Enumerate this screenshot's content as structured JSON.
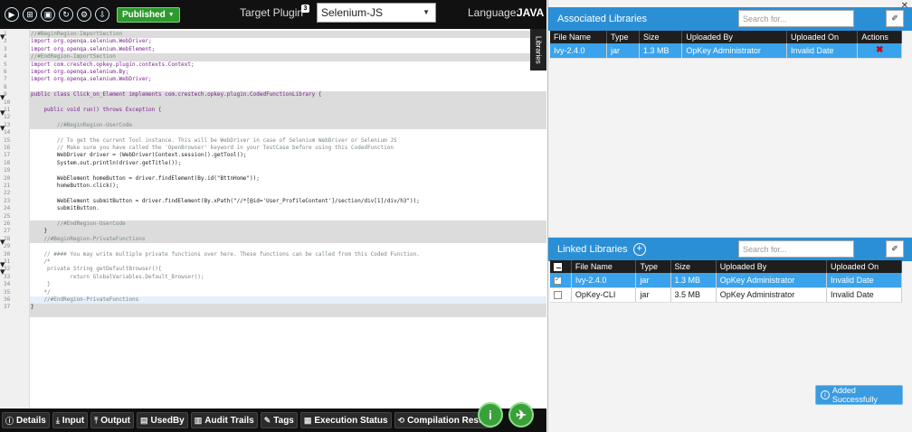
{
  "toolbar": {
    "icons": [
      "play-icon",
      "add-icon",
      "save-icon",
      "refresh-icon",
      "debug-icon",
      "export-icon"
    ],
    "published_label": "Published",
    "target_plugin_label": "Target Plugin",
    "target_plugin_badge": "3",
    "target_plugin_value": "Selenium-JS",
    "language_label": "Language:",
    "language_value": "JAVA",
    "libraries_tab": "Libraries"
  },
  "editor": {
    "lines": [
      {
        "n": "1",
        "t": "//#BeginRegion-ImportSection",
        "c": "cm",
        "g": true,
        "f": "▾"
      },
      {
        "n": "2",
        "t": "import org.openqa.selenium.WebDriver;",
        "c": "kw"
      },
      {
        "n": "3",
        "t": "import org.openqa.selenium.WebElement;",
        "c": "kw"
      },
      {
        "n": "4",
        "t": "//#EndRegion-ImportSection",
        "c": "cm",
        "g": true
      },
      {
        "n": "5",
        "t": "import com.crestech.opkey.plugin.contexts.Context;",
        "c": "kw"
      },
      {
        "n": "6",
        "t": "import org.openqa.selenium.By;",
        "c": "kw"
      },
      {
        "n": "7",
        "t": "import org.openqa.selenium.WebDriver;",
        "c": "kw"
      },
      {
        "n": "8",
        "t": "",
        "c": "nm"
      },
      {
        "n": "9",
        "t": "public class Click_on_Element implements com.crestech.opkey.plugin.CodedFunctionLibrary {",
        "c": "kw",
        "g": true,
        "f": "▾"
      },
      {
        "n": "10",
        "t": "",
        "c": "nm",
        "g": true
      },
      {
        "n": "11",
        "t": "    public void run() throws Exception {",
        "c": "kw",
        "g": true,
        "f": "▾"
      },
      {
        "n": "12",
        "t": "",
        "c": "nm",
        "g": true
      },
      {
        "n": "13",
        "t": "        //#BeginRegion-UserCode",
        "c": "cm",
        "g": true,
        "f": "▾"
      },
      {
        "n": "14",
        "t": "",
        "c": "nm"
      },
      {
        "n": "15",
        "t": "        // To get the current Tool instance. This will be WebDriver in case of Selenium WebDriver or Selenium JS",
        "c": "cm"
      },
      {
        "n": "16",
        "t": "        // Make sure you have called the 'OpenBrowser' keyword in your TestCase before using this CodedFunction",
        "c": "cm"
      },
      {
        "n": "17",
        "t": "        WebDriver driver = (WebDriver)Context.session().getTool();",
        "c": "nm"
      },
      {
        "n": "18",
        "t": "        System.out.println(driver.getTitle());",
        "c": "nm"
      },
      {
        "n": "19",
        "t": "",
        "c": "nm"
      },
      {
        "n": "20",
        "t": "        WebElement homeButton = driver.findElement(By.id(\"BttnHome\"));",
        "c": "nm"
      },
      {
        "n": "21",
        "t": "        homeButton.click();",
        "c": "nm"
      },
      {
        "n": "22",
        "t": "",
        "c": "nm"
      },
      {
        "n": "23",
        "t": "        WebElement submitButton = driver.findElement(By.xPath(\"//*[@id='User_ProfileContent']/section/div[1]/div/h3\"));",
        "c": "nm"
      },
      {
        "n": "24",
        "t": "        submitButton.",
        "c": "nm"
      },
      {
        "n": "25",
        "t": "",
        "c": "nm"
      },
      {
        "n": "26",
        "t": "        //#EndRegion-UserCode",
        "c": "cm",
        "g": true
      },
      {
        "n": "27",
        "t": "    }",
        "c": "nm",
        "g": true
      },
      {
        "n": "28",
        "t": "    //#BeginRegion-PrivateFunctions",
        "c": "cm",
        "g": true,
        "f": "▾"
      },
      {
        "n": "29",
        "t": "",
        "c": "nm"
      },
      {
        "n": "30",
        "t": "    // #### You may write multiple private functions over here. These functions can be called from this Coded Function.",
        "c": "cm"
      },
      {
        "n": "31",
        "t": "    /*",
        "c": "cm",
        "f": "▾"
      },
      {
        "n": "32",
        "t": "     private String getDefaultBrowser(){",
        "c": "cm",
        "f": "▾"
      },
      {
        "n": "33",
        "t": "            return GlobalVariables.Default_Browser();",
        "c": "cm"
      },
      {
        "n": "34",
        "t": "     }",
        "c": "cm"
      },
      {
        "n": "35",
        "t": "    */",
        "c": "cm"
      },
      {
        "n": "36",
        "t": "    //#EndRegion-PrivateFunctions",
        "c": "cm",
        "hl": true
      },
      {
        "n": "37",
        "t": "}",
        "c": "nm",
        "g": true
      }
    ]
  },
  "bottom_tabs": [
    {
      "label": "Details",
      "icon": "info-icon",
      "glyph": "ⓘ"
    },
    {
      "label": "Input",
      "icon": "input-icon",
      "glyph": "⤓"
    },
    {
      "label": "Output",
      "icon": "output-icon",
      "glyph": "⤒"
    },
    {
      "label": "UsedBy",
      "icon": "usedby-icon",
      "glyph": "▤"
    },
    {
      "label": "Audit Trails",
      "icon": "audit-icon",
      "glyph": "▥"
    },
    {
      "label": "Tags",
      "icon": "tag-icon",
      "glyph": "✎"
    },
    {
      "label": "Execution Status",
      "icon": "status-icon",
      "glyph": "▦"
    },
    {
      "label": "Compilation Result",
      "icon": "compile-icon",
      "glyph": "⟲"
    }
  ],
  "associated": {
    "title": "Associated Libraries",
    "search_placeholder": "Search for...",
    "columns": [
      "File Name",
      "Type",
      "Size",
      "Uploaded By",
      "Uploaded On",
      "Actions"
    ],
    "rows": [
      {
        "file": "Ivy-2.4.0",
        "type": "jar",
        "size": "1.3 MB",
        "by": "OpKey Administrator",
        "on": "Invalid Date"
      }
    ]
  },
  "linked": {
    "title": "Linked Libraries",
    "search_placeholder": "Search for...",
    "columns": [
      "File Name",
      "Type",
      "Size",
      "Uploaded By",
      "Uploaded On"
    ],
    "rows": [
      {
        "file": "Ivy-2.4.0",
        "type": "jar",
        "size": "1.3 MB",
        "by": "OpKey Administrator",
        "on": "Invalid Date",
        "checked": true
      },
      {
        "file": "OpKey-CLI",
        "type": "jar",
        "size": "3.5 MB",
        "by": "OpKey Administrator",
        "on": "Invalid Date",
        "checked": false
      }
    ]
  },
  "toast": "Added Successfully",
  "close_glyph": "✕",
  "colors": {
    "accent": "#2b8fd6",
    "selected_row": "#3aa3ec",
    "published": "#2e9a2e"
  }
}
